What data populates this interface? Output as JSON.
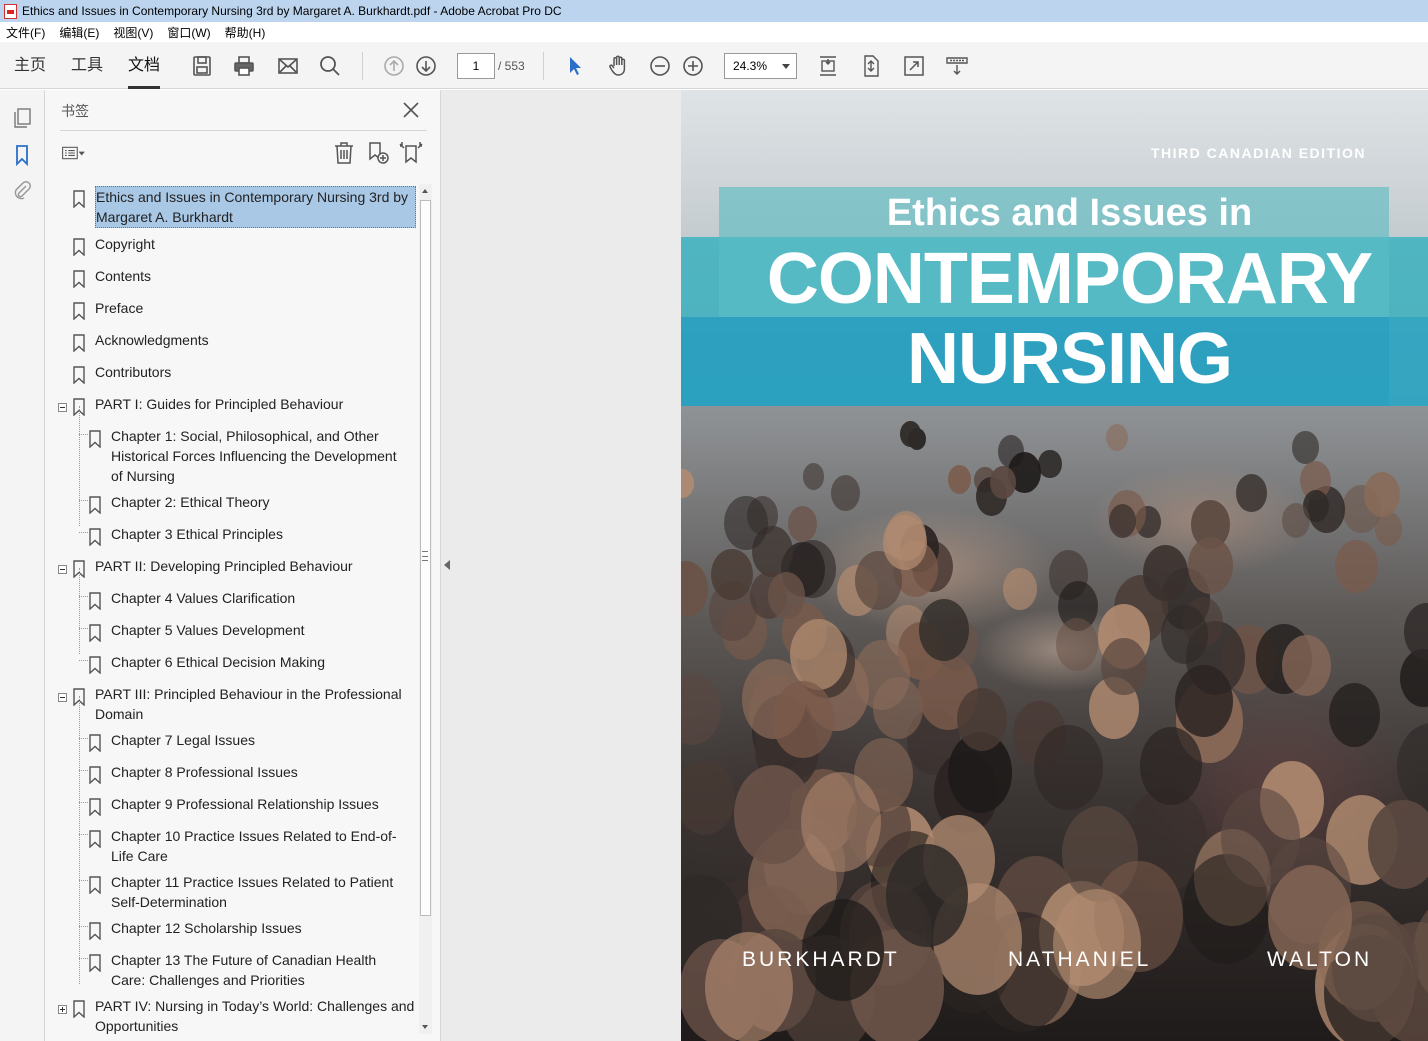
{
  "window": {
    "title": "Ethics and Issues in Contemporary Nursing 3rd by Margaret A. Burkhardt.pdf - Adobe Acrobat Pro DC"
  },
  "menubar": [
    "文件(F)",
    "编辑(E)",
    "视图(V)",
    "窗口(W)",
    "帮助(H)"
  ],
  "toolbar": {
    "tabs": [
      "主页",
      "工具",
      "文档"
    ],
    "active_tab": "文档",
    "page_current": "1",
    "page_total": "/ 553",
    "zoom": "24.3%"
  },
  "panel": {
    "title": "书签"
  },
  "bookmarks": [
    {
      "label": "Ethics and Issues in Contemporary Nursing 3rd by Margaret A. Burkhardt",
      "level": 0,
      "selected": true
    },
    {
      "label": "Copyright",
      "level": 0
    },
    {
      "label": "Contents",
      "level": 0
    },
    {
      "label": "Preface",
      "level": 0
    },
    {
      "label": "Acknowledgments",
      "level": 0
    },
    {
      "label": "Contributors",
      "level": 0
    },
    {
      "label": "PART I: Guides for Principled Behaviour",
      "level": 0,
      "expander": "minus"
    },
    {
      "label": "Chapter 1: Social, Philosophical, and Other Historical Forces Influencing the Development of Nursing",
      "level": 1
    },
    {
      "label": "Chapter 2: Ethical Theory",
      "level": 1
    },
    {
      "label": "Chapter 3 Ethical Principles",
      "level": 1
    },
    {
      "label": "PART II: Developing Principled Behaviour",
      "level": 0,
      "expander": "minus"
    },
    {
      "label": "Chapter 4 Values Clarification",
      "level": 1
    },
    {
      "label": "Chapter 5 Values Development",
      "level": 1
    },
    {
      "label": "Chapter 6 Ethical Decision Making",
      "level": 1
    },
    {
      "label": "PART III: Principled Behaviour in the Professional Domain",
      "level": 0,
      "expander": "minus"
    },
    {
      "label": "Chapter 7 Legal Issues",
      "level": 1
    },
    {
      "label": "Chapter 8 Professional Issues",
      "level": 1
    },
    {
      "label": "Chapter 9 Professional Relationship Issues",
      "level": 1
    },
    {
      "label": "Chapter 10 Practice Issues Related to End-of-Life Care",
      "level": 1
    },
    {
      "label": "Chapter 11 Practice Issues Related to Patient Self-Determination",
      "level": 1
    },
    {
      "label": "Chapter 12 Scholarship Issues",
      "level": 1
    },
    {
      "label": "Chapter 13 The Future of Canadian Health Care: Challenges and Priorities",
      "level": 1
    },
    {
      "label": "PART IV: Nursing in Today’s World: Challenges and Opportunities",
      "level": 0,
      "expander": "plus"
    }
  ],
  "cover": {
    "edition": "THIRD CANADIAN EDITION",
    "title_line1": "Ethics and Issues in",
    "title_line2": "CONTEMPORARY",
    "title_line3": "NURSING",
    "authors": [
      "BURKHARDT",
      "NATHANIEL",
      "WALTON"
    ]
  },
  "colors": {
    "selection": "#a9c8e6",
    "cover_band": "#2ea6c3",
    "titlebar": "#bcd4ee"
  }
}
